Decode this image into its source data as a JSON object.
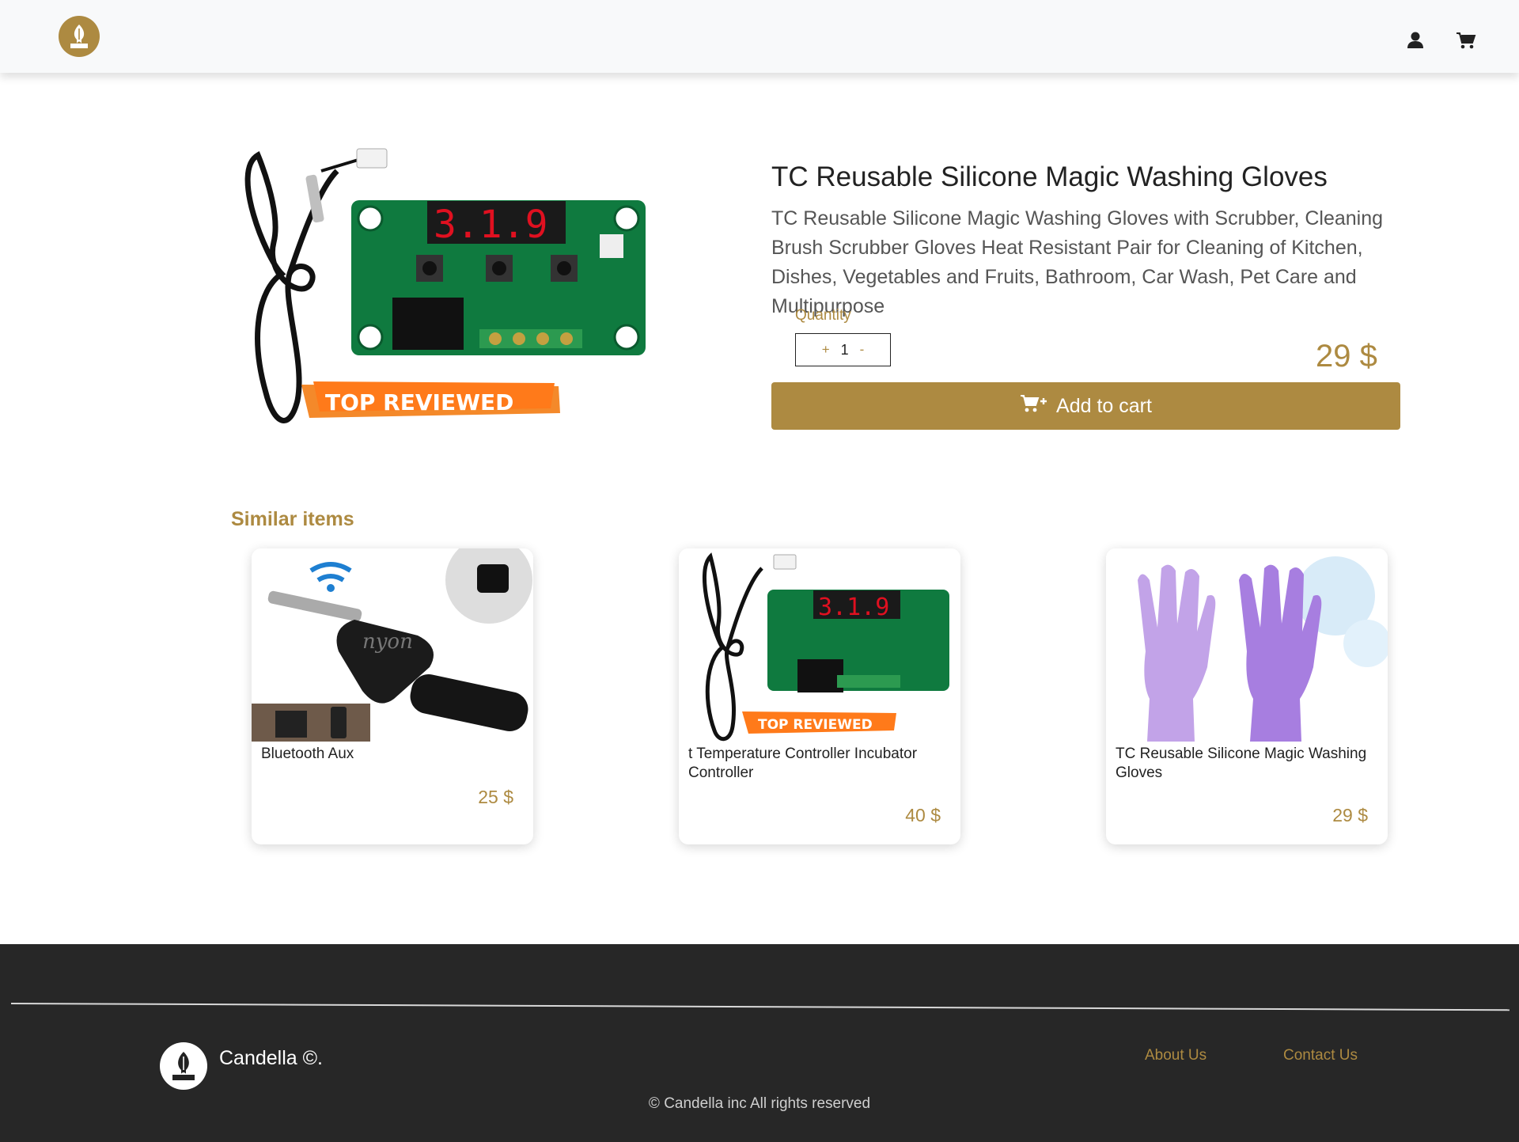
{
  "colors": {
    "accent": "#ad8a41",
    "footer_bg": "#272727",
    "navbar_bg": "#f8f9fa"
  },
  "navbar": {
    "logo_icon": "candle-leaf-logo",
    "icons": [
      "user-icon",
      "cart-icon"
    ]
  },
  "product": {
    "image_badge": "TOP REVIEWED",
    "image_display": "3.1.9",
    "title": "TC Reusable Silicone Magic Washing Gloves",
    "description": "TC Reusable Silicone Magic Washing Gloves with Scrubber, Cleaning Brush Scrubber Gloves Heat Resistant Pair for Cleaning of Kitchen, Dishes, Vegetables and Fruits, Bathroom, Car Wash, Pet Care and Multipurpose",
    "quantity_label": "Quantity",
    "quantity_plus": "+",
    "quantity_value": "1",
    "quantity_minus": "-",
    "price": "29 $",
    "add_to_cart_icon": "cart-plus-icon",
    "add_to_cart_label": "Add to cart"
  },
  "similar": {
    "title": "Similar items",
    "items": [
      {
        "name": "Bluetooth Aux",
        "price": "25 $",
        "image": "bluetooth-aux-image"
      },
      {
        "name": "t Temperature Controller Incubator Controller",
        "price": "40 $",
        "image": "temperature-controller-image",
        "badge": "TOP REVIEWED"
      },
      {
        "name": "TC Reusable Silicone Magic Washing Gloves",
        "price": "29 $",
        "image": "silicone-gloves-image"
      }
    ]
  },
  "footer": {
    "brand": "Candella ©.",
    "links": [
      "About Us",
      "Contact Us"
    ],
    "copyright": "© Candella inc All rights reserved"
  }
}
